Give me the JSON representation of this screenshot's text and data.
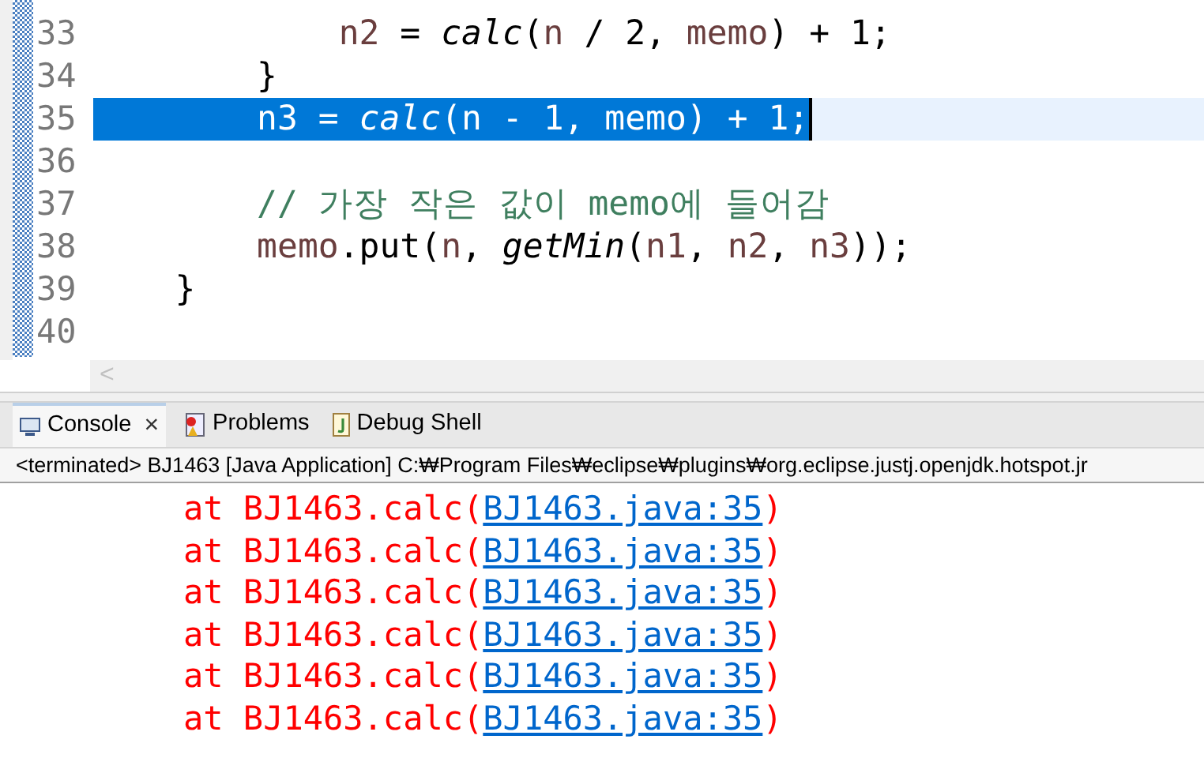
{
  "editor": {
    "lines": [
      {
        "number": "33",
        "selected": false,
        "tokens": [
          {
            "kind": "var",
            "text": "            n2"
          },
          {
            "kind": "plain",
            "text": " = "
          },
          {
            "kind": "static",
            "text": "calc"
          },
          {
            "kind": "plain",
            "text": "("
          },
          {
            "kind": "var",
            "text": "n"
          },
          {
            "kind": "plain",
            "text": " / 2, "
          },
          {
            "kind": "var",
            "text": "memo"
          },
          {
            "kind": "plain",
            "text": ") + 1;"
          }
        ]
      },
      {
        "number": "34",
        "selected": false,
        "tokens": [
          {
            "kind": "plain",
            "text": "        }"
          }
        ]
      },
      {
        "number": "35",
        "selected": true,
        "tokens": [
          {
            "kind": "var",
            "text": "        n3"
          },
          {
            "kind": "plain",
            "text": " = "
          },
          {
            "kind": "static",
            "text": "calc"
          },
          {
            "kind": "plain",
            "text": "("
          },
          {
            "kind": "var",
            "text": "n"
          },
          {
            "kind": "plain",
            "text": " - 1, "
          },
          {
            "kind": "var",
            "text": "memo"
          },
          {
            "kind": "plain",
            "text": ") + 1;"
          }
        ]
      },
      {
        "number": "36",
        "selected": false
      },
      {
        "number": "37",
        "selected": false,
        "tokens": [
          {
            "kind": "comment",
            "text": "        // 가장 작은 값이 memo에 들어감"
          }
        ]
      },
      {
        "number": "38",
        "selected": false,
        "tokens": [
          {
            "kind": "var",
            "text": "        memo"
          },
          {
            "kind": "plain",
            "text": ".put("
          },
          {
            "kind": "var",
            "text": "n"
          },
          {
            "kind": "plain",
            "text": ", "
          },
          {
            "kind": "static",
            "text": "getMin"
          },
          {
            "kind": "plain",
            "text": "("
          },
          {
            "kind": "var",
            "text": "n1"
          },
          {
            "kind": "plain",
            "text": ", "
          },
          {
            "kind": "var",
            "text": "n2"
          },
          {
            "kind": "plain",
            "text": ", "
          },
          {
            "kind": "var",
            "text": "n3"
          },
          {
            "kind": "plain",
            "text": "));"
          }
        ]
      },
      {
        "number": "39",
        "selected": false,
        "tokens": [
          {
            "kind": "plain",
            "text": "    }"
          }
        ]
      },
      {
        "number": "40",
        "selected": false
      }
    ],
    "scroll_left": "<"
  },
  "tabs": [
    {
      "label": "Console",
      "selected": true,
      "close": "×"
    },
    {
      "label": "Problems",
      "selected": false
    },
    {
      "label": "Debug Shell",
      "selected": false
    }
  ],
  "console": {
    "description": "<terminated> BJ1463 [Java Application] C:₩Program Files₩eclipse₩plugins₩org.eclipse.justj.openjdk.hotspot.jr",
    "lines": [
      {
        "text": "at BJ1463.calc(",
        "link": "BJ1463.java:35",
        "suffix": ")"
      },
      {
        "text": "at BJ1463.calc(",
        "link": "BJ1463.java:35",
        "suffix": ")"
      },
      {
        "text": "at BJ1463.calc(",
        "link": "BJ1463.java:35",
        "suffix": ")"
      },
      {
        "text": "at BJ1463.calc(",
        "link": "BJ1463.java:35",
        "suffix": ")"
      },
      {
        "text": "at BJ1463.calc(",
        "link": "BJ1463.java:35",
        "suffix": ")"
      },
      {
        "text": "at BJ1463.calc(",
        "link": "BJ1463.java:35",
        "suffix": ")"
      }
    ]
  }
}
